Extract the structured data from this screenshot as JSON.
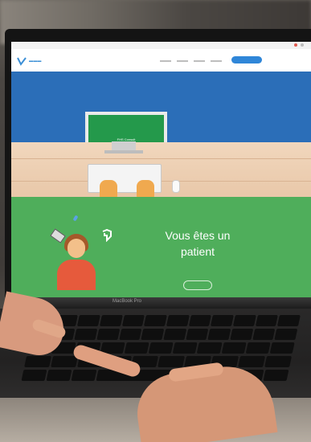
{
  "screen": {
    "monitor_caption": "FHS Consult",
    "headline_line1": "Vous êtes un",
    "headline_line2": "patient"
  },
  "laptop": {
    "model": "MacBook Pro"
  },
  "colors": {
    "hero_blue": "#2b6eb8",
    "green": "#4fae5b",
    "accent_blue": "#2f86d8"
  }
}
